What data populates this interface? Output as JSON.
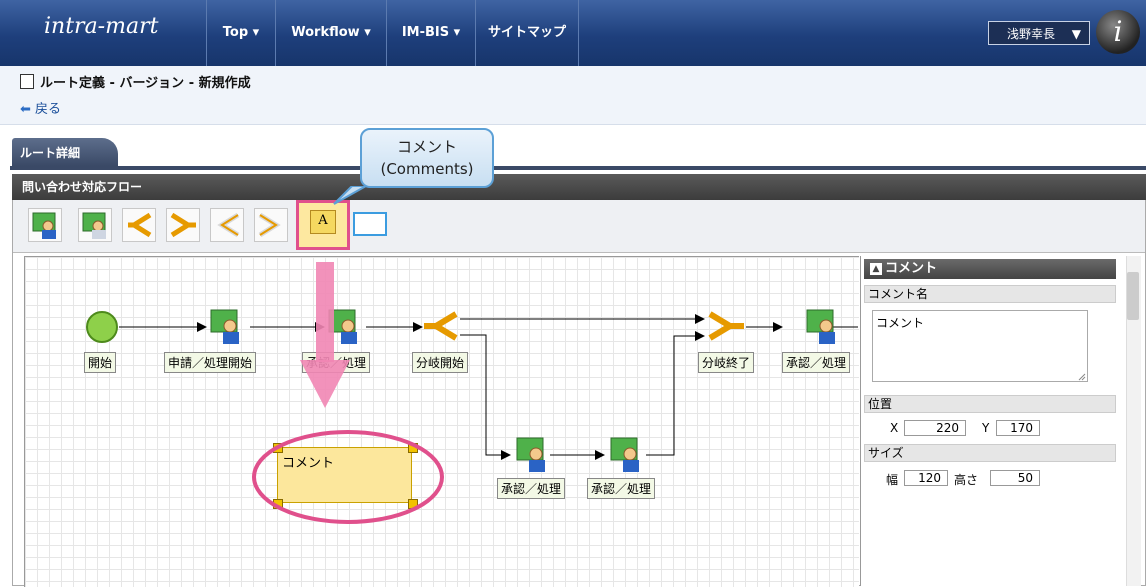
{
  "topbar": {
    "logo": "intra-mart",
    "nav": [
      {
        "label": "Top ▾"
      },
      {
        "label": "Workflow ▾"
      },
      {
        "label": "IM-BIS ▾"
      },
      {
        "label": "サイトマップ"
      }
    ],
    "user": "浅野幸長",
    "user_caret": "▼"
  },
  "page": {
    "title": "ルート定義 - バージョン - 新規作成",
    "back": "戻る"
  },
  "tab": {
    "label": "ルート詳細"
  },
  "flow": {
    "title": "問い合わせ対応フロー"
  },
  "callout": {
    "line1": "コメント",
    "line2": "(Comments)"
  },
  "toolbar": {
    "comment_tool_text": "A"
  },
  "nodes": {
    "start": "開始",
    "apply": "申請／処理開始",
    "approve1": "承認／処理",
    "branch_start": "分岐開始",
    "branch_end": "分岐終了",
    "approve2": "承認／処理",
    "approve3": "承認／処理",
    "approve4": "承認／処理"
  },
  "comment_node": {
    "text": "コメント"
  },
  "properties": {
    "header": "コメント",
    "name_label": "コメント名",
    "name_value": "コメント",
    "position_label": "位置",
    "x_label": "X",
    "x_value": "220",
    "y_label": "Y",
    "y_value": "170",
    "size_label": "サイズ",
    "width_label": "幅",
    "width_value": "120",
    "height_label": "高さ",
    "height_value": "50"
  },
  "colors": {
    "nav_bg": "#1e3f7c",
    "highlight": "#e0508c",
    "comment_fill": "#fce79c"
  }
}
